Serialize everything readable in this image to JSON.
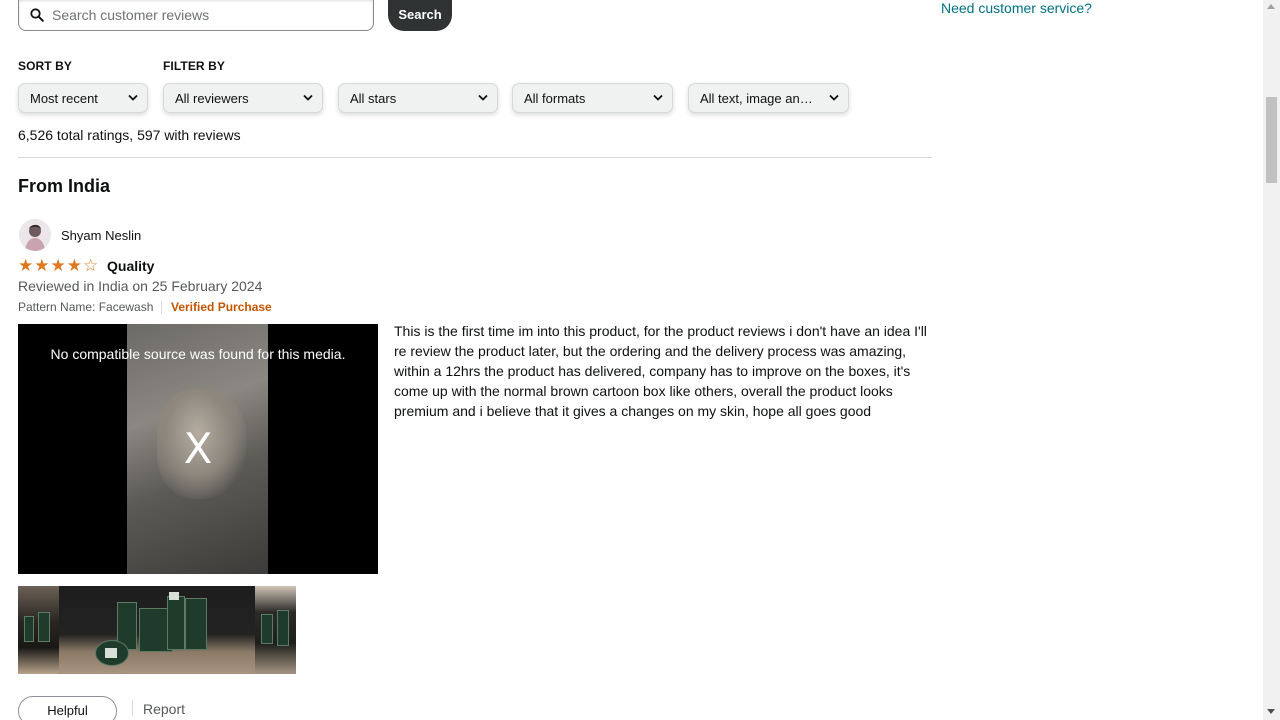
{
  "search": {
    "placeholder": "Search customer reviews",
    "button_label": "Search"
  },
  "sidebar": {
    "customer_service_link": "Need customer service?"
  },
  "sort": {
    "label": "SORT BY",
    "selected": "Most recent"
  },
  "filter": {
    "label": "FILTER BY",
    "reviewers": "All reviewers",
    "stars": "All stars",
    "formats": "All formats",
    "media": "All text, image an…"
  },
  "summary": {
    "totals": "6,526 total ratings, 597 with reviews"
  },
  "section": {
    "title": "From India"
  },
  "review": {
    "reviewer_name": "Shyam Neslin",
    "rating": 4,
    "rating_max": 5,
    "title": "Quality",
    "date_line": "Reviewed in India on 25 February 2024",
    "pattern": "Pattern Name: Facewash",
    "verified": "Verified Purchase",
    "video_error": "No compatible source was found for this media.",
    "video_close": "X",
    "body": "This is the first time im into this product, for the product reviews i don't have an idea I'll re review the product later, but the ordering and the delivery process was amazing, within a 12hrs the product has delivered, company has to improve on the boxes, it's come up with the normal brown cartoon box like others, overall the product looks premium and i believe that it gives a changes on my skin, hope all goes good",
    "helpful_label": "Helpful",
    "report_label": "Report"
  },
  "colors": {
    "link": "#007185",
    "verified": "#c45500",
    "star": "#de7921",
    "search_button_bg": "#303333"
  },
  "icons": {
    "search": "magnifier-icon",
    "dropdown": "chevron-down-icon",
    "star_full": "star-filled-icon",
    "star_empty": "star-empty-icon"
  }
}
